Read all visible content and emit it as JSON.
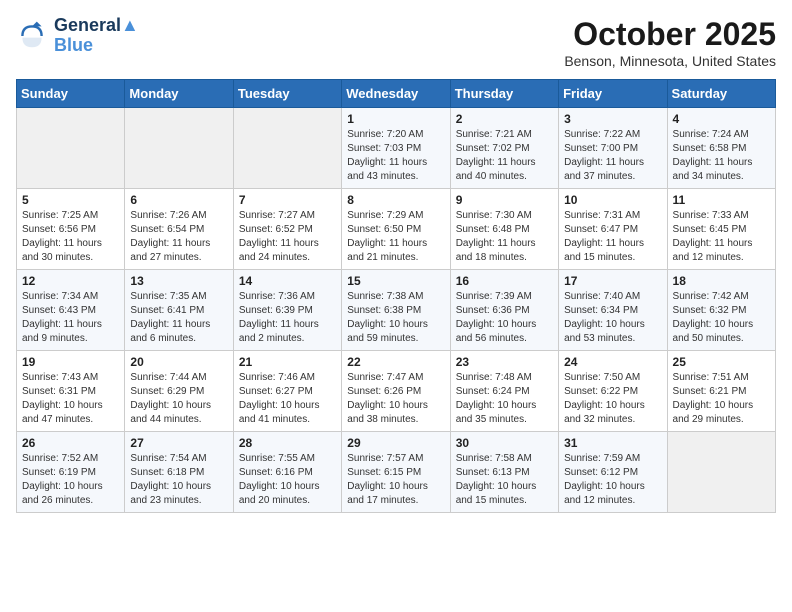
{
  "header": {
    "logo_line1": "General",
    "logo_line2": "Blue",
    "month": "October 2025",
    "location": "Benson, Minnesota, United States"
  },
  "weekdays": [
    "Sunday",
    "Monday",
    "Tuesday",
    "Wednesday",
    "Thursday",
    "Friday",
    "Saturday"
  ],
  "weeks": [
    [
      {
        "day": "",
        "info": ""
      },
      {
        "day": "",
        "info": ""
      },
      {
        "day": "",
        "info": ""
      },
      {
        "day": "1",
        "info": "Sunrise: 7:20 AM\nSunset: 7:03 PM\nDaylight: 11 hours\nand 43 minutes."
      },
      {
        "day": "2",
        "info": "Sunrise: 7:21 AM\nSunset: 7:02 PM\nDaylight: 11 hours\nand 40 minutes."
      },
      {
        "day": "3",
        "info": "Sunrise: 7:22 AM\nSunset: 7:00 PM\nDaylight: 11 hours\nand 37 minutes."
      },
      {
        "day": "4",
        "info": "Sunrise: 7:24 AM\nSunset: 6:58 PM\nDaylight: 11 hours\nand 34 minutes."
      }
    ],
    [
      {
        "day": "5",
        "info": "Sunrise: 7:25 AM\nSunset: 6:56 PM\nDaylight: 11 hours\nand 30 minutes."
      },
      {
        "day": "6",
        "info": "Sunrise: 7:26 AM\nSunset: 6:54 PM\nDaylight: 11 hours\nand 27 minutes."
      },
      {
        "day": "7",
        "info": "Sunrise: 7:27 AM\nSunset: 6:52 PM\nDaylight: 11 hours\nand 24 minutes."
      },
      {
        "day": "8",
        "info": "Sunrise: 7:29 AM\nSunset: 6:50 PM\nDaylight: 11 hours\nand 21 minutes."
      },
      {
        "day": "9",
        "info": "Sunrise: 7:30 AM\nSunset: 6:48 PM\nDaylight: 11 hours\nand 18 minutes."
      },
      {
        "day": "10",
        "info": "Sunrise: 7:31 AM\nSunset: 6:47 PM\nDaylight: 11 hours\nand 15 minutes."
      },
      {
        "day": "11",
        "info": "Sunrise: 7:33 AM\nSunset: 6:45 PM\nDaylight: 11 hours\nand 12 minutes."
      }
    ],
    [
      {
        "day": "12",
        "info": "Sunrise: 7:34 AM\nSunset: 6:43 PM\nDaylight: 11 hours\nand 9 minutes."
      },
      {
        "day": "13",
        "info": "Sunrise: 7:35 AM\nSunset: 6:41 PM\nDaylight: 11 hours\nand 6 minutes."
      },
      {
        "day": "14",
        "info": "Sunrise: 7:36 AM\nSunset: 6:39 PM\nDaylight: 11 hours\nand 2 minutes."
      },
      {
        "day": "15",
        "info": "Sunrise: 7:38 AM\nSunset: 6:38 PM\nDaylight: 10 hours\nand 59 minutes."
      },
      {
        "day": "16",
        "info": "Sunrise: 7:39 AM\nSunset: 6:36 PM\nDaylight: 10 hours\nand 56 minutes."
      },
      {
        "day": "17",
        "info": "Sunrise: 7:40 AM\nSunset: 6:34 PM\nDaylight: 10 hours\nand 53 minutes."
      },
      {
        "day": "18",
        "info": "Sunrise: 7:42 AM\nSunset: 6:32 PM\nDaylight: 10 hours\nand 50 minutes."
      }
    ],
    [
      {
        "day": "19",
        "info": "Sunrise: 7:43 AM\nSunset: 6:31 PM\nDaylight: 10 hours\nand 47 minutes."
      },
      {
        "day": "20",
        "info": "Sunrise: 7:44 AM\nSunset: 6:29 PM\nDaylight: 10 hours\nand 44 minutes."
      },
      {
        "day": "21",
        "info": "Sunrise: 7:46 AM\nSunset: 6:27 PM\nDaylight: 10 hours\nand 41 minutes."
      },
      {
        "day": "22",
        "info": "Sunrise: 7:47 AM\nSunset: 6:26 PM\nDaylight: 10 hours\nand 38 minutes."
      },
      {
        "day": "23",
        "info": "Sunrise: 7:48 AM\nSunset: 6:24 PM\nDaylight: 10 hours\nand 35 minutes."
      },
      {
        "day": "24",
        "info": "Sunrise: 7:50 AM\nSunset: 6:22 PM\nDaylight: 10 hours\nand 32 minutes."
      },
      {
        "day": "25",
        "info": "Sunrise: 7:51 AM\nSunset: 6:21 PM\nDaylight: 10 hours\nand 29 minutes."
      }
    ],
    [
      {
        "day": "26",
        "info": "Sunrise: 7:52 AM\nSunset: 6:19 PM\nDaylight: 10 hours\nand 26 minutes."
      },
      {
        "day": "27",
        "info": "Sunrise: 7:54 AM\nSunset: 6:18 PM\nDaylight: 10 hours\nand 23 minutes."
      },
      {
        "day": "28",
        "info": "Sunrise: 7:55 AM\nSunset: 6:16 PM\nDaylight: 10 hours\nand 20 minutes."
      },
      {
        "day": "29",
        "info": "Sunrise: 7:57 AM\nSunset: 6:15 PM\nDaylight: 10 hours\nand 17 minutes."
      },
      {
        "day": "30",
        "info": "Sunrise: 7:58 AM\nSunset: 6:13 PM\nDaylight: 10 hours\nand 15 minutes."
      },
      {
        "day": "31",
        "info": "Sunrise: 7:59 AM\nSunset: 6:12 PM\nDaylight: 10 hours\nand 12 minutes."
      },
      {
        "day": "",
        "info": ""
      }
    ]
  ]
}
